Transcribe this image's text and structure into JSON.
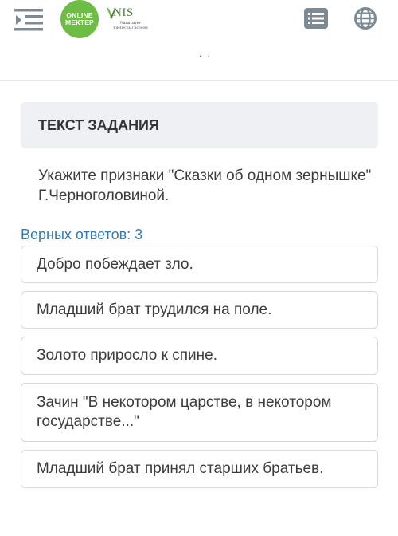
{
  "header": {
    "logo_online": [
      "ONLINE",
      "МЕКТЕР"
    ],
    "logo_nis_title": "NIS",
    "logo_nis_subtitle": "Nazarbayev Intellectual Schools",
    "icons": {
      "menu": "menu-collapse-icon",
      "list": "list-icon",
      "globe": "globe-icon"
    },
    "colors": {
      "online_logo": "#6dbd45",
      "icon_gray": "#7d8a94"
    }
  },
  "page_indicator": ". .",
  "task": {
    "header": "ТЕКСТ ЗАДАНИЯ",
    "question": "Укажите признаки \"Сказки об одном зернышке\" Г.Черноголовиной.",
    "correct_count_label": "Верных ответов: 3",
    "answers": [
      "Добро побеждает зло.",
      "Младший брат трудился на поле.",
      "Золото приросло к спине.",
      "Зачин \"В некотором царстве, в некотором государстве...\"",
      "Младший брат принял старших братьев."
    ]
  },
  "colors": {
    "accent_blue": "#2e7bb5",
    "header_bg": "#eef0f3"
  }
}
